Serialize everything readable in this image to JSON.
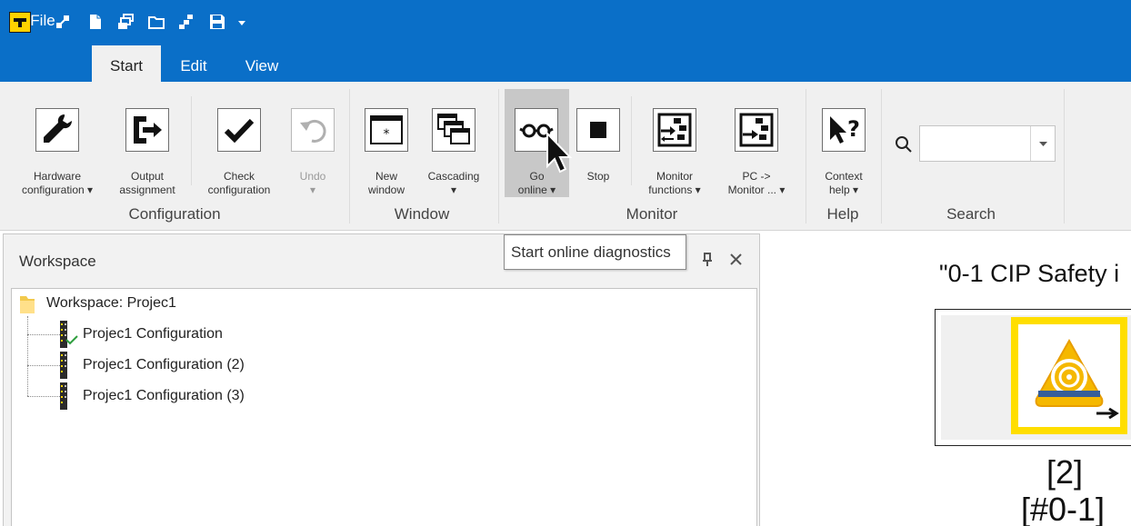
{
  "titlebar": {
    "quick_access": [
      "connect-icon",
      "new-document-icon",
      "new-project-icon",
      "open-folder-icon",
      "network-icon",
      "save-icon",
      "customize-dropdown-icon"
    ]
  },
  "tabs": [
    {
      "label": "File",
      "active": false
    },
    {
      "label": "Start",
      "active": true
    },
    {
      "label": "Edit",
      "active": false
    },
    {
      "label": "View",
      "active": false
    }
  ],
  "ribbon": {
    "buttons": {
      "hardware_configuration": {
        "line1": "Hardware",
        "line2": "configuration ▾"
      },
      "output_assignment": {
        "line1": "Output",
        "line2": "assignment"
      },
      "check_configuration": {
        "line1": "Check",
        "line2": "configuration"
      },
      "undo": {
        "line1": "Undo",
        "line2": "▾",
        "disabled": true
      },
      "new_window": {
        "line1": "New",
        "line2": "window"
      },
      "cascading": {
        "line1": "Cascading",
        "line2": "▾"
      },
      "go_online": {
        "line1": "Go",
        "line2": "online ▾"
      },
      "stop": {
        "line1": "Stop",
        "line2": ""
      },
      "monitor_functions": {
        "line1": "Monitor",
        "line2": "functions ▾"
      },
      "pc_monitor": {
        "line1": "PC ->",
        "line2": "Monitor ... ▾"
      },
      "context_help": {
        "line1": "Context",
        "line2": "help ▾"
      }
    },
    "groups": {
      "configuration": "Configuration",
      "window": "Window",
      "monitor": "Monitor",
      "help": "Help",
      "search": "Search"
    },
    "search": {
      "value": "",
      "icon": "search-icon"
    }
  },
  "tooltip": {
    "text": "Start online diagnostics"
  },
  "workspace": {
    "title": "Workspace",
    "tree": {
      "root": "Workspace: Projec1",
      "items": [
        {
          "label": "Projec1 Configuration",
          "checked": true
        },
        {
          "label": "Projec1 Configuration (2)",
          "checked": false
        },
        {
          "label": "Projec1 Configuration (3)",
          "checked": false
        }
      ]
    }
  },
  "canvas": {
    "device_title": "\"0-1 CIP Safety i",
    "device_index": "[2]",
    "device_address": "[#0-1]"
  },
  "colors": {
    "titlebar": "#0a6fc8",
    "ribbon": "#f0f0f0",
    "device_frame": "#ffde00"
  }
}
